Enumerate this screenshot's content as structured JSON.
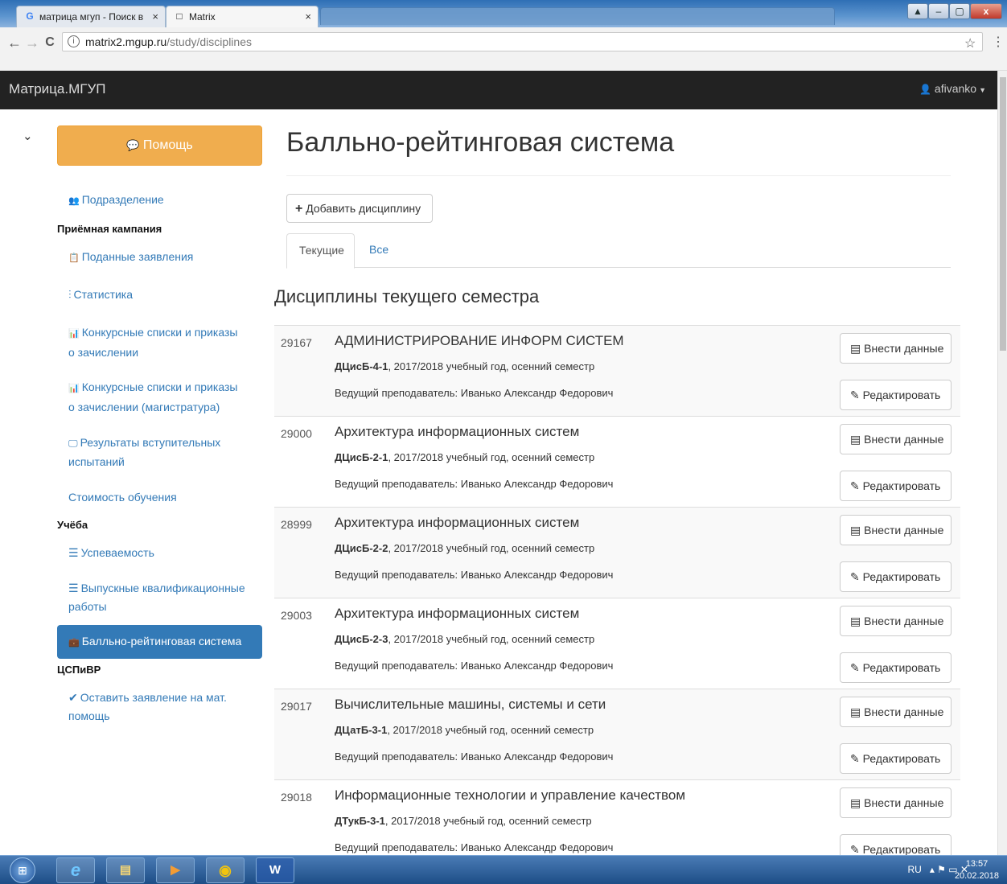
{
  "browser": {
    "tabs": [
      {
        "favicon": "G",
        "label": "матрица мгуп - Поиск в",
        "close": "×"
      },
      {
        "favicon": "□",
        "label": "Matrix",
        "close": "×"
      }
    ],
    "window_controls": [
      "▲",
      "–",
      "▢",
      "x"
    ],
    "url_host": "matrix2.mgup.ru",
    "url_path": "/study/disciplines",
    "back": "←",
    "forward": "→",
    "reload": "C",
    "info": "i",
    "bookmark": "☆",
    "menu": "⋮"
  },
  "navbar": {
    "brand": "Матрица.МГУП",
    "user": "afivanko",
    "user_caret": "▼",
    "user_icon": "👤"
  },
  "sidebar": {
    "chevron": "⌄",
    "help_button": "Помощь",
    "help_icon": "💬",
    "division": {
      "icon": "👥",
      "label": "Подразделение"
    },
    "section_admission": "Приёмная кампания",
    "applications": {
      "icon": "📋",
      "label": "Поданные заявления"
    },
    "statistics": {
      "icon": "⫶",
      "label": "Статистика"
    },
    "lists_line1": {
      "icon": "📊",
      "label": "Конкурсные списки и приказы"
    },
    "lists_line2": "о зачислении",
    "lists_mag_line1": {
      "icon": "📊",
      "label": "Конкурсные списки и приказы"
    },
    "lists_mag_line2": "о зачислении (магистратура)",
    "exam_results_line1": {
      "icon": "🖵",
      "label": "Результаты вступительных"
    },
    "exam_results_line2": "испытаний",
    "tuition": "Стоимость обучения",
    "section_study": "Учёба",
    "progress": {
      "icon": "☰",
      "label": "Успеваемость"
    },
    "thesis_line1": {
      "icon": "☰",
      "label": "Выпускные квалификационные"
    },
    "thesis_line2": "работы",
    "active_item": {
      "icon": "💼",
      "label": "Балльно-рейтинговая система"
    },
    "section_csp": "ЦСПиВР",
    "aid_line1": {
      "icon": "✔",
      "label": "Оставить заявление на мат."
    },
    "aid_line2": "помощь"
  },
  "main": {
    "title": "Балльно-рейтинговая система",
    "add_button": "Добавить дисциплину",
    "add_icon": "+",
    "tab_current": "Текущие",
    "tab_all": "Все",
    "section_title": "Дисциплины текущего семестра",
    "enter_label": "Внести данные",
    "enter_icon": "▤",
    "edit_label": "Редактировать",
    "edit_icon": "✎",
    "disciplines": [
      {
        "id": "29167",
        "name": "АДМИНИСТРИРОВАНИЕ ИНФОРМ СИСТЕМ",
        "group": "ДЦисБ-4-1",
        "term": ", 2017/2018 учебный год, осенний семестр",
        "teacher": "Ведущий преподаватель: Иванько Александр Федорович"
      },
      {
        "id": "29000",
        "name": "Архитектура информационных систем",
        "group": "ДЦисБ-2-1",
        "term": ", 2017/2018 учебный год, осенний семестр",
        "teacher": "Ведущий преподаватель: Иванько Александр Федорович"
      },
      {
        "id": "28999",
        "name": "Архитектура информационных систем",
        "group": "ДЦисБ-2-2",
        "term": ", 2017/2018 учебный год, осенний семестр",
        "teacher": "Ведущий преподаватель: Иванько Александр Федорович"
      },
      {
        "id": "29003",
        "name": "Архитектура информационных систем",
        "group": "ДЦисБ-2-3",
        "term": ", 2017/2018 учебный год, осенний семестр",
        "teacher": "Ведущий преподаватель: Иванько Александр Федорович"
      },
      {
        "id": "29017",
        "name": "Вычислительные машины, системы и сети",
        "group": "ДЦатБ-3-1",
        "term": ", 2017/2018 учебный год, осенний семестр",
        "teacher": "Ведущий преподаватель: Иванько Александр Федорович"
      },
      {
        "id": "29018",
        "name": "Информационные технологии и управление качеством",
        "group": "ДТукБ-3-1",
        "term": ", 2017/2018 учебный год, осенний семестр",
        "teacher": "Ведущий преподаватель: Иванько Александр Федорович"
      }
    ]
  },
  "taskbar": {
    "start": "⊞",
    "apps": [
      {
        "name": "ie-icon",
        "glyph": "e"
      },
      {
        "name": "explorer-icon",
        "glyph": "▤"
      },
      {
        "name": "media-player-icon",
        "glyph": "▶"
      },
      {
        "name": "chrome-icon",
        "glyph": "◉"
      },
      {
        "name": "word-icon",
        "glyph": "W"
      }
    ],
    "lang": "RU",
    "tray_icons": "▴ ⚑ ▭ ✕",
    "time": "13:57",
    "date": "20.02.2018"
  }
}
